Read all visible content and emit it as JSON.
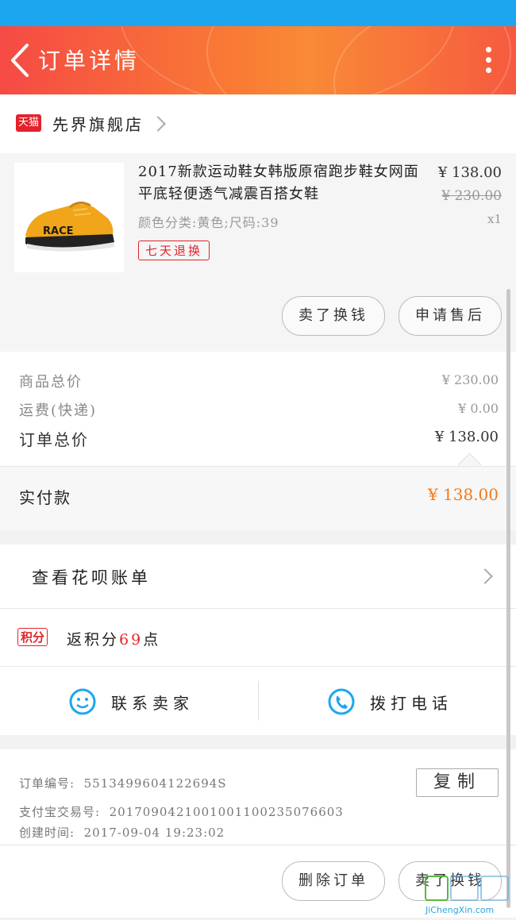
{
  "header": {
    "title": "订单详情"
  },
  "shop": {
    "badge": "天猫",
    "name": "先界旗舰店"
  },
  "product": {
    "title": "2017新款运动鞋女韩版原宿跑步鞋女网面平底轻便透气减震百搭女鞋",
    "sku": "颜色分类:黄色;尺码:39",
    "tag": "七天退换",
    "price": "¥ 138.00",
    "original_price": "¥ 230.00",
    "quantity": "x1",
    "shoe_text": "RACE",
    "buttons": {
      "sell_swap": "卖了换钱",
      "after_sale": "申请售后"
    }
  },
  "totals": {
    "goods_total_label": "商品总价",
    "goods_total_value": "¥ 230.00",
    "shipping_label": "运费(快递)",
    "shipping_value": "¥ 0.00",
    "order_total_label": "订单总价",
    "order_total_value": "¥ 138.00",
    "paid_label": "实付款",
    "paid_value": "¥ 138.00"
  },
  "huabei": {
    "label": "查看花呗账单"
  },
  "points": {
    "badge": "积分",
    "text_prefix": "返积分",
    "amount": "69",
    "text_suffix": "点"
  },
  "contact": {
    "seller": "联系卖家",
    "call": "拨打电话"
  },
  "order_info": {
    "number_label": "订单编号:",
    "number_value": "5513499604122694S",
    "alipay_label": "支付宝交易号:",
    "alipay_value": "2017090421001001100235076603",
    "created_label": "创建时间:",
    "created_value": "2017-09-04 19:23:02",
    "copy_button": "复制"
  },
  "bottom_actions": {
    "delete_order": "删除订单",
    "sell_swap": "卖了换钱"
  },
  "watermark": {
    "text": "JiChengXin.com"
  },
  "colors": {
    "status_bar": "#1da6f0",
    "accent_red": "#e3232c",
    "paid_orange": "#f27a1a",
    "icon_blue": "#1da6f0"
  }
}
